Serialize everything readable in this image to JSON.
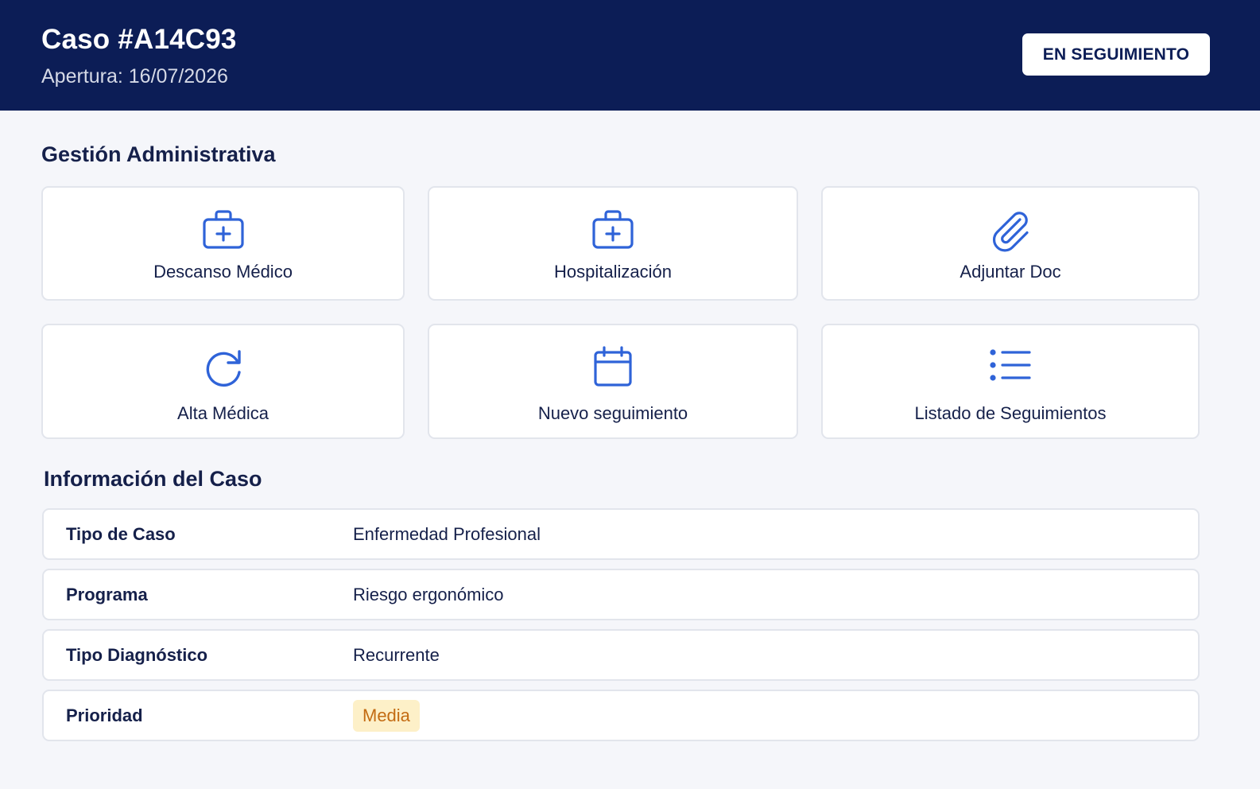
{
  "header": {
    "title": "Caso #A14C93",
    "opened": "Apertura: 16/07/2026",
    "status": "EN SEGUIMIENTO"
  },
  "admin": {
    "title": "Gestión Administrativa",
    "actions": [
      {
        "label": "Descanso Médico",
        "icon": "medical-kit-icon"
      },
      {
        "label": "Hospitalización",
        "icon": "medical-kit-icon"
      },
      {
        "label": "Adjuntar Doc",
        "icon": "paperclip-icon"
      },
      {
        "label": "Alta Médica",
        "icon": "refresh-icon"
      },
      {
        "label": "Nuevo seguimiento",
        "icon": "calendar-icon"
      },
      {
        "label": "Listado de Seguimientos",
        "icon": "list-icon"
      }
    ]
  },
  "info": {
    "title": "Información del Caso",
    "rows": [
      {
        "label": "Tipo de Caso",
        "value": "Enfermedad Profesional"
      },
      {
        "label": "Programa",
        "value": "Riesgo ergonómico"
      },
      {
        "label": "Tipo Diagnóstico",
        "value": "Recurrente"
      },
      {
        "label": "Prioridad",
        "value": "Media"
      }
    ]
  },
  "colors": {
    "header_bg": "#0c1d56",
    "accent": "#2f63d8",
    "priority_bg": "#fdf0c8",
    "priority_text": "#c36b12"
  }
}
